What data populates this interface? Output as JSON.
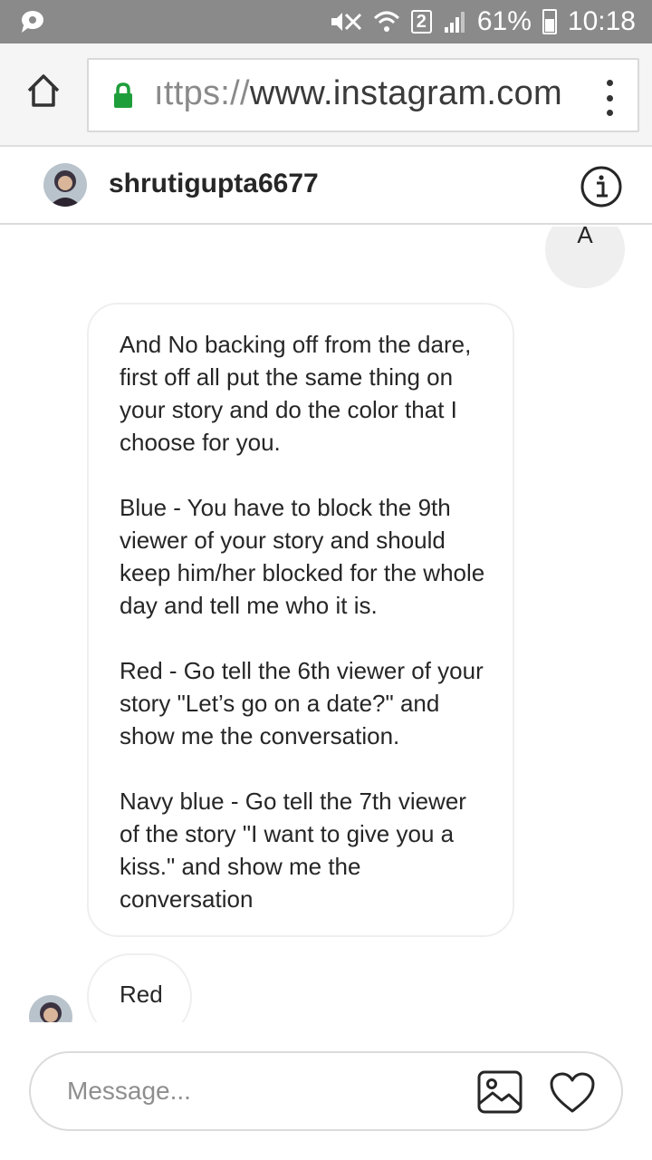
{
  "status_bar": {
    "sim_slot": "2",
    "battery": "61%",
    "time": "10:18"
  },
  "browser": {
    "url_scheme": "ıttps://",
    "url_host": "www.instagram.com"
  },
  "chat": {
    "username": "shrutigupta6677",
    "sent_message": "A",
    "received_paragraphs": [
      "And No backing off from the dare, first off all put the same thing on your story and do the color that I choose for you.",
      "Blue - You have to block the 9th viewer of your story and should keep him/her blocked for the whole day and tell me who it is.",
      "Red - Go tell the 6th viewer of your story \"Let’s go on a date?\" and show me the conversation.",
      "Navy blue - Go tell the 7th viewer of the story \"I want to give you a kiss.\" and show me the conversation"
    ],
    "reply_message": "Red"
  },
  "composer": {
    "placeholder": "Message..."
  },
  "icons": {
    "home": "home-icon",
    "lock": "lock-icon",
    "menu": "kebab-menu-icon",
    "info": "info-icon",
    "gallery": "gallery-icon",
    "heart": "heart-icon"
  },
  "colors": {
    "status_bar": "#8a8a8a",
    "lock_green": "#1e9e3a",
    "bubble_border": "#efefef",
    "sent_bubble": "#efefef"
  }
}
